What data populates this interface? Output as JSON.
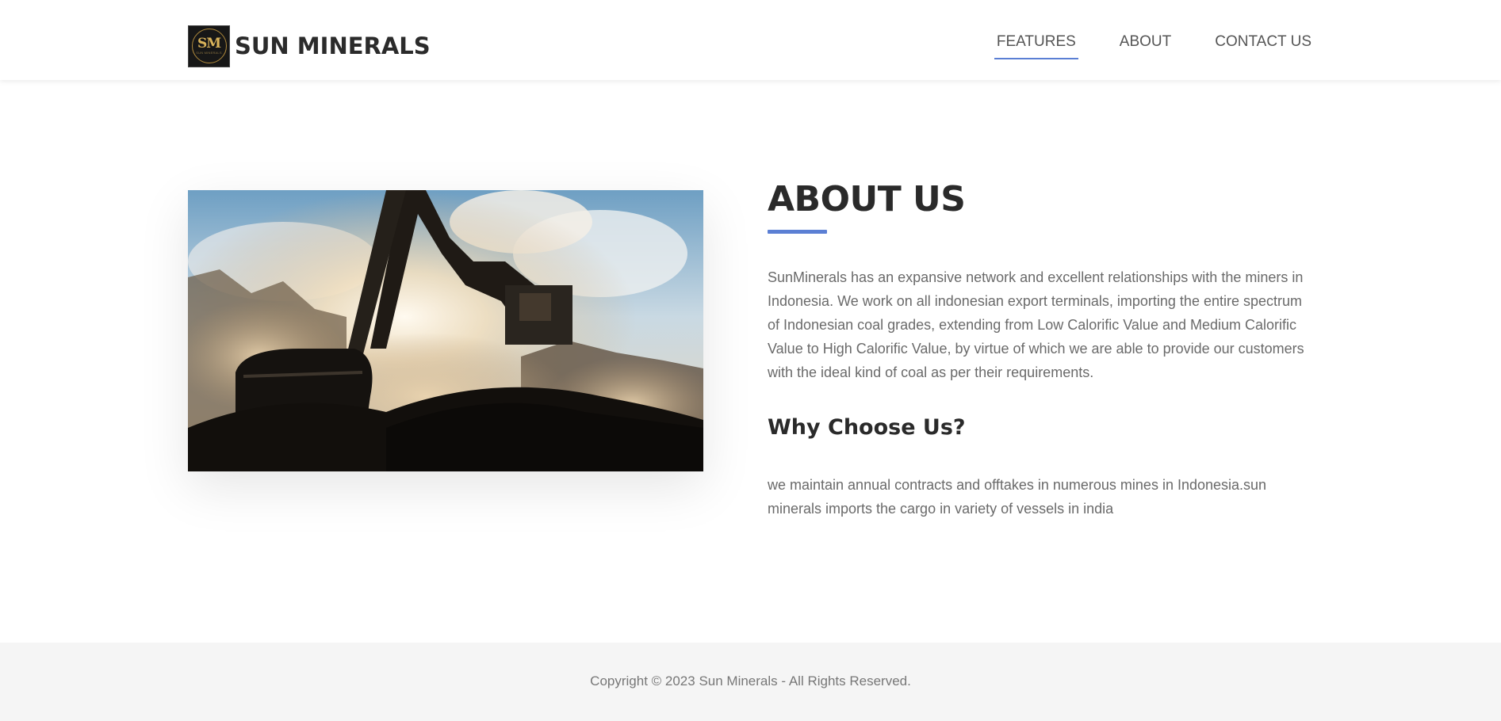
{
  "header": {
    "logo_monogram": "SM",
    "logo_subtext": "SUN MINERALS",
    "brand_name": "SUN MINERALS",
    "nav": [
      {
        "label": "FEATURES",
        "active": true
      },
      {
        "label": "ABOUT",
        "active": false
      },
      {
        "label": "CONTACT US",
        "active": false
      }
    ]
  },
  "about": {
    "title": "ABOUT US",
    "description": "SunMinerals has an expansive network and excellent relationships with the miners in Indonesia. We work on all indonesian export terminals, importing the entire spectrum of Indonesian coal grades, extending from Low Calorific Value and Medium Calorific Value to High Calorific Value, by virtue of which we are able to provide our customers with the ideal kind of coal as per their requirements.",
    "why_title": "Why Choose Us?",
    "why_text": "we maintain annual contracts and offtakes in numerous mines in Indonesia.sun minerals imports the cargo in variety of vessels in india"
  },
  "footer": {
    "copyright": "Copyright © 2023 Sun Minerals - All Rights Reserved."
  },
  "colors": {
    "accent": "#5b7fd4",
    "heading": "#2a2a2a",
    "body_text": "#6a6a6a",
    "footer_bg": "#f5f5f5"
  },
  "icons": {
    "logo": "sm-monogram-logo",
    "hero": "excavator-coal-mine-photo"
  }
}
